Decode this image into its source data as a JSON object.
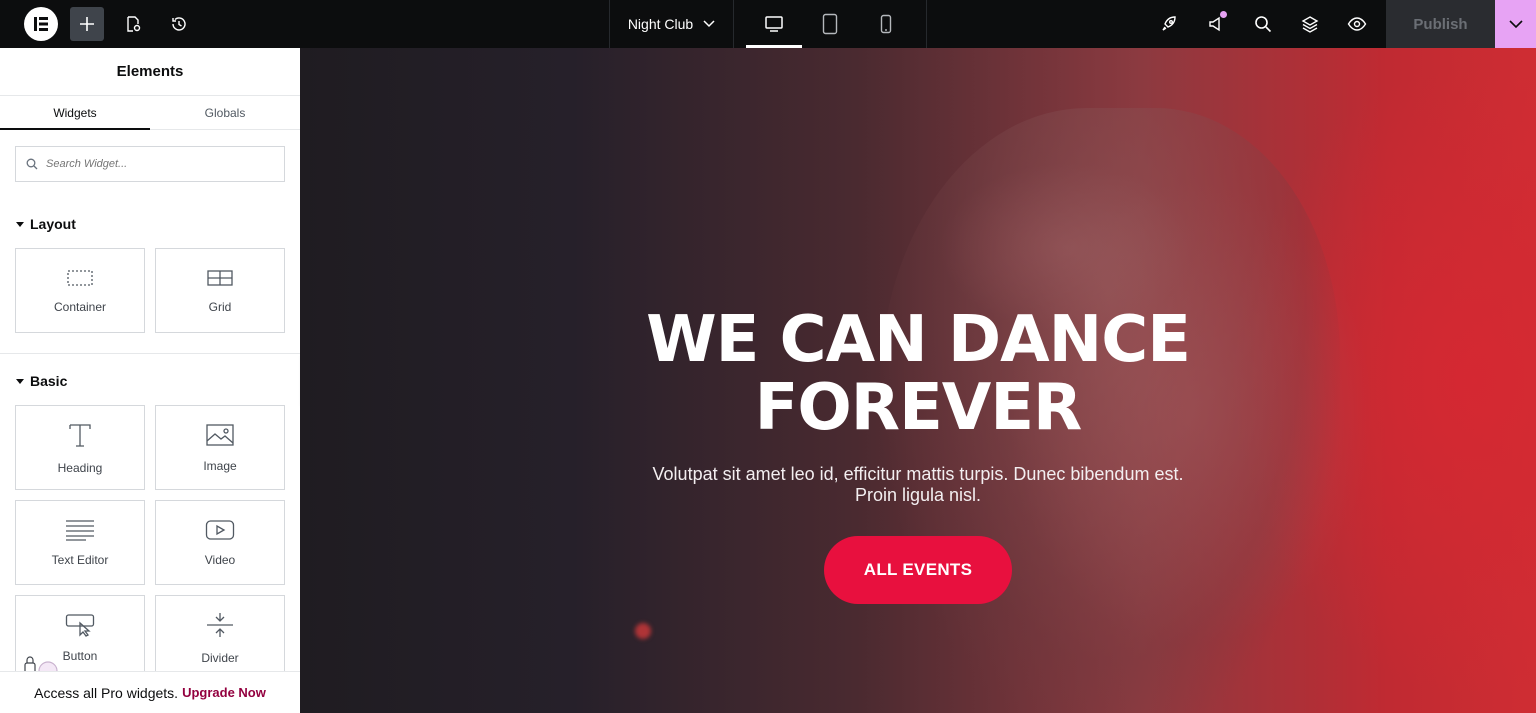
{
  "topbar": {
    "page_name": "Night Club",
    "publish_label": "Publish"
  },
  "sidebar": {
    "title": "Elements",
    "tabs": [
      "Widgets",
      "Globals"
    ],
    "search_placeholder": "Search Widget...",
    "categories": [
      {
        "name": "Layout",
        "widgets": [
          "Container",
          "Grid"
        ]
      },
      {
        "name": "Basic",
        "widgets": [
          "Heading",
          "Image",
          "Text Editor",
          "Video",
          "Button",
          "Divider"
        ]
      }
    ],
    "promo_text": "Access all Pro widgets.",
    "promo_link": "Upgrade Now"
  },
  "hero": {
    "heading_line1": "WE CAN DANCE",
    "heading_line2": "FOREVER",
    "text_line1": "Volutpat sit amet leo id, efficitur mattis turpis. Dunec bibendum est.",
    "text_line2": "Proin ligula nisl.",
    "button": "ALL EVENTS"
  },
  "colors": {
    "topbar_bg": "#0c0d0e",
    "accent_pink": "#e7a3f4",
    "cta": "#e8103e",
    "upgrade_link": "#93003f"
  }
}
